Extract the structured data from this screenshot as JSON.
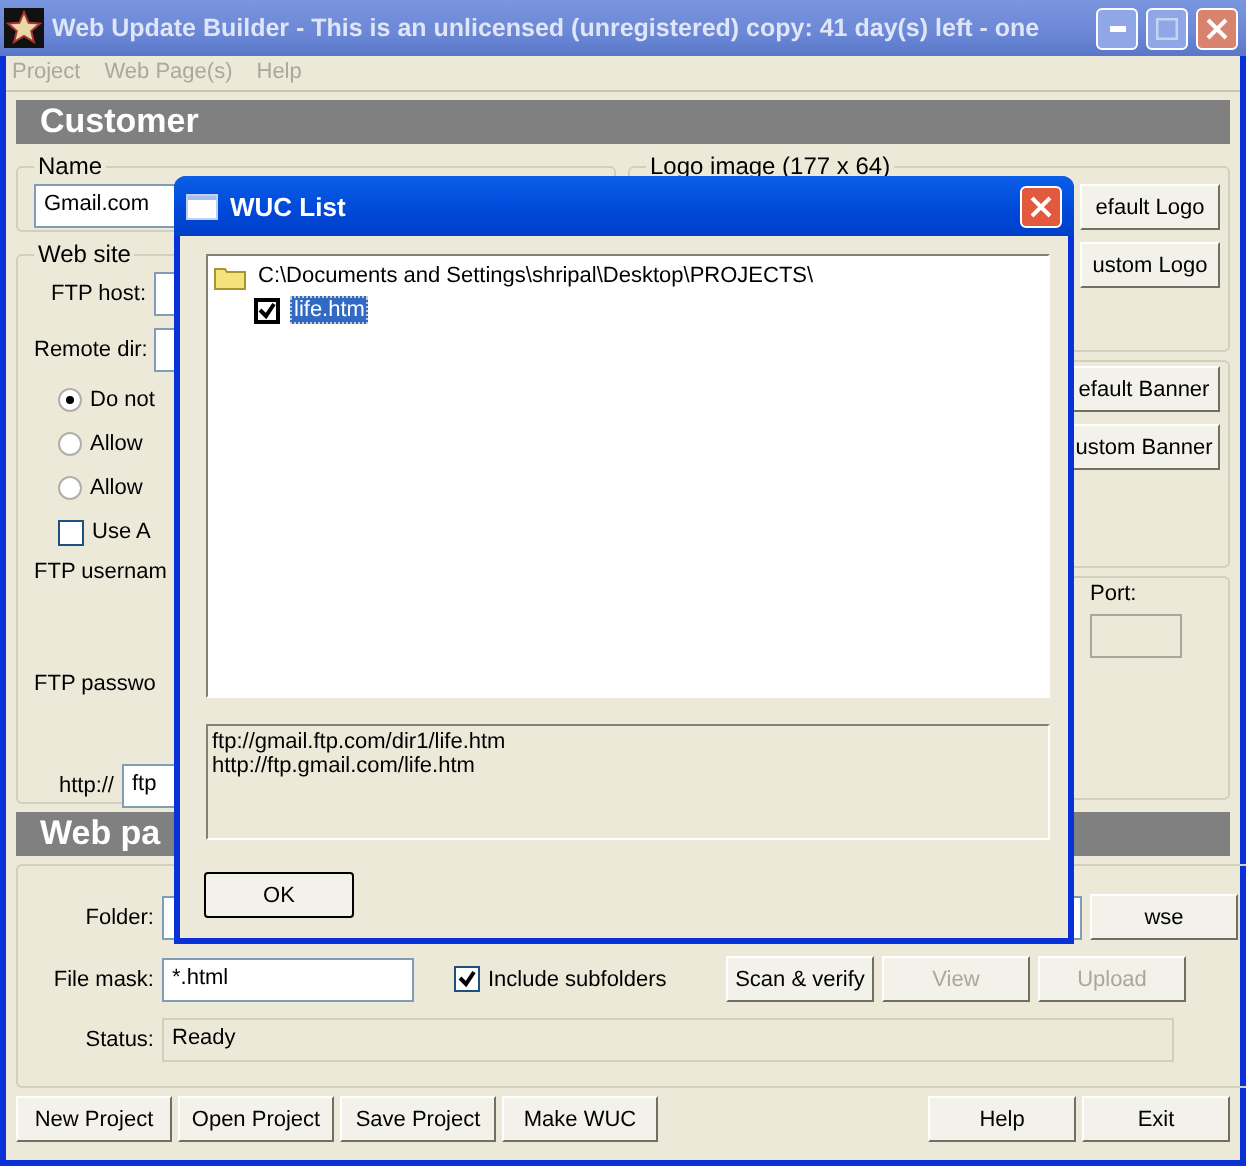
{
  "window": {
    "title": "Web Update Builder - This is an unlicensed (unregistered) copy: 41 day(s) left - one"
  },
  "menu": [
    "Project",
    "Web Page(s)",
    "Help"
  ],
  "customer": {
    "header": "Customer",
    "name_group": {
      "legend": "Name",
      "value": "Gmail.com"
    },
    "web_site": {
      "legend": "Web site",
      "ftp_host_label": "FTP host:",
      "remote_dir_label": "Remote dir:",
      "options": [
        {
          "kind": "radio",
          "label": "Do not",
          "selected": true
        },
        {
          "kind": "radio",
          "label": "Allow",
          "selected": false
        },
        {
          "kind": "radio",
          "label": "Allow",
          "selected": false
        },
        {
          "kind": "checkbox",
          "label": "Use A",
          "checked": false
        }
      ],
      "ftp_username_label": "FTP usernam",
      "ftp_password_label": "FTP passwo",
      "url_prefix": "http://",
      "url_value": "ftp"
    },
    "logo_group": {
      "legend": "Logo image (177 x 64)",
      "buttons": [
        "efault Logo",
        "ustom Logo"
      ]
    },
    "banner_buttons": [
      "efault Banner",
      "ustom Banner"
    ],
    "port_label": "Port:"
  },
  "web_pages": {
    "header": "Web pa",
    "folder_label": "Folder:",
    "browse_button": "wse",
    "file_mask_label": "File mask:",
    "file_mask_value": "*.html",
    "include_subfolders": {
      "label": "Include subfolders",
      "checked": true
    },
    "buttons": [
      {
        "label": "Scan & verify",
        "disabled": false
      },
      {
        "label": "View",
        "disabled": true
      },
      {
        "label": "Upload",
        "disabled": true
      }
    ],
    "status_label": "Status:",
    "status_value": "Ready"
  },
  "footer_buttons": [
    "New Project",
    "Open Project",
    "Save Project",
    "Make WUC",
    "Help",
    "Exit"
  ],
  "dialog": {
    "title": "WUC List",
    "tree": [
      {
        "label": "C:\\Documents and Settings\\shripal\\Desktop\\PROJECTS\\",
        "children": [
          {
            "label": "life.htm",
            "checked": true,
            "selected": true
          }
        ]
      }
    ],
    "urls": [
      "ftp://gmail.ftp.com/dir1/life.htm",
      "http://ftp.gmail.com/life.htm"
    ],
    "ok_button": "OK"
  }
}
